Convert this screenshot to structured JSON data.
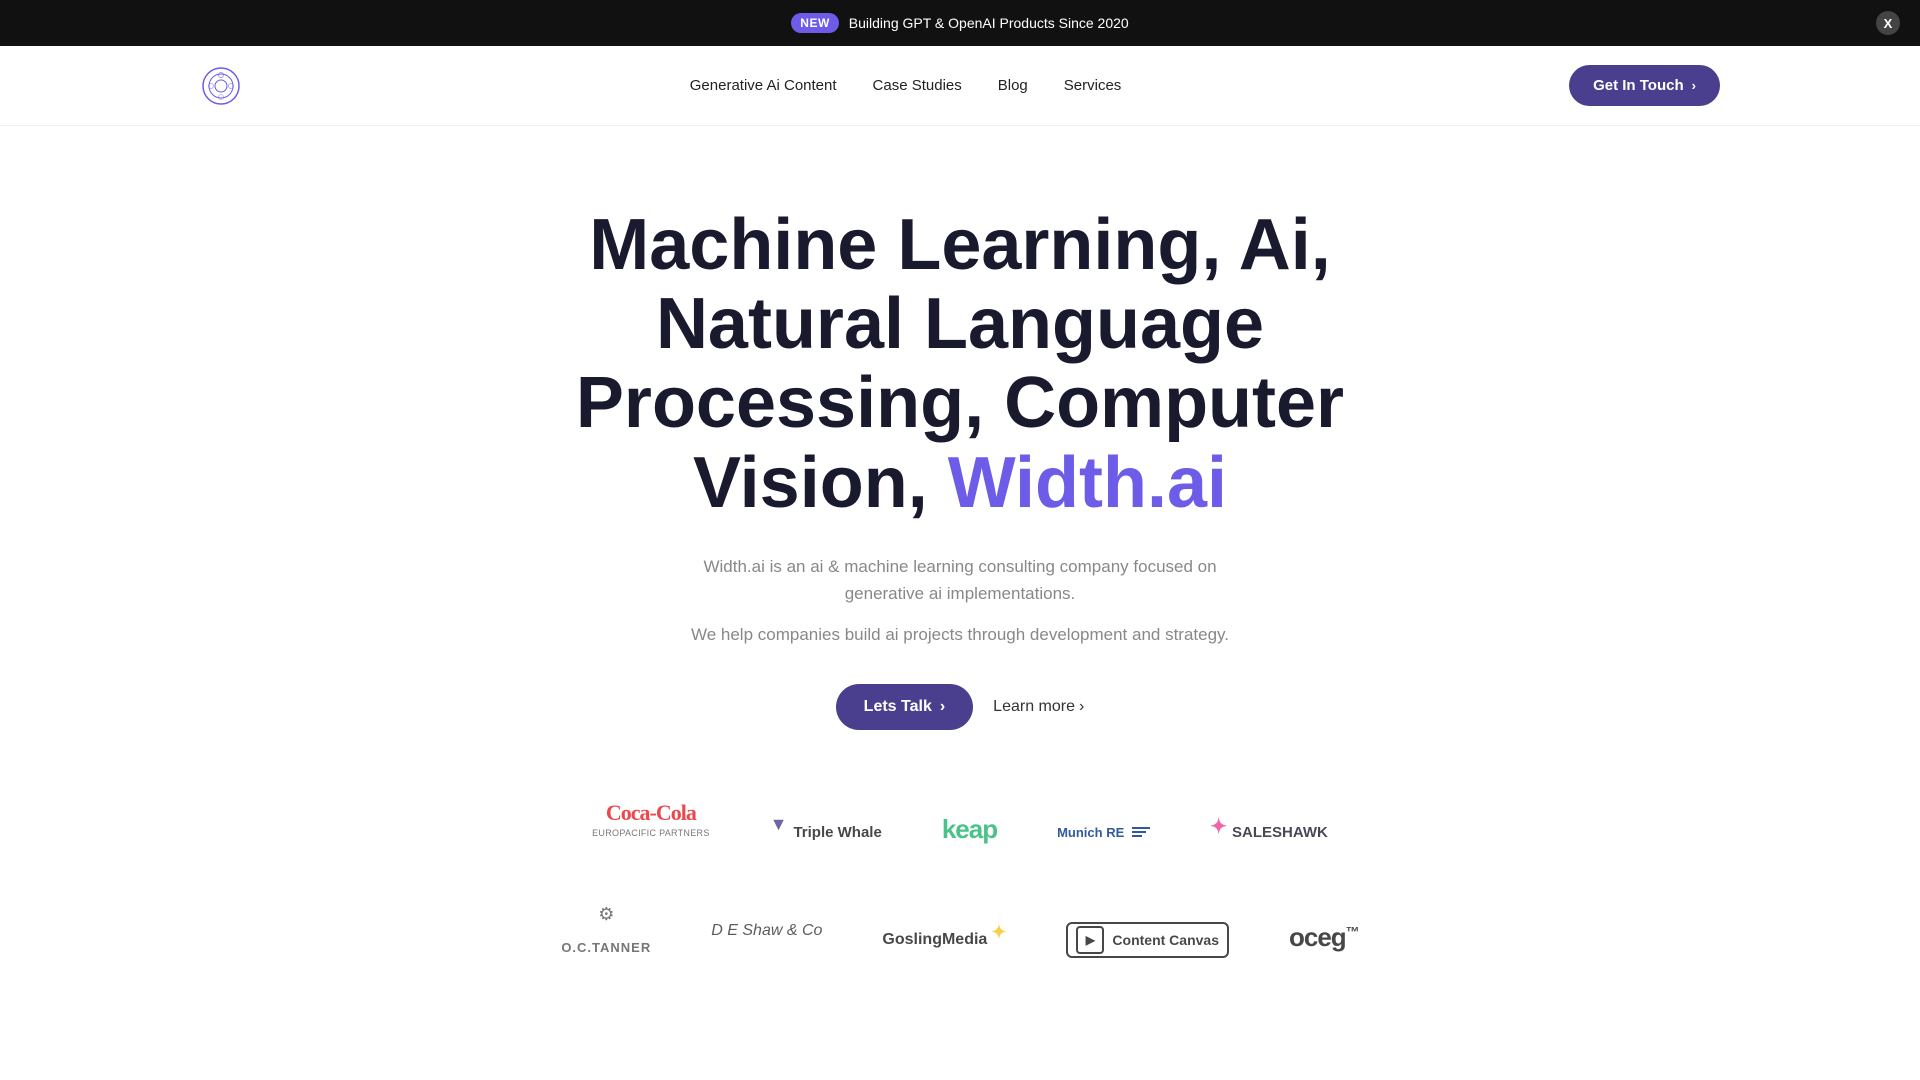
{
  "banner": {
    "badge": "NEW",
    "message": "Building GPT & OpenAI Products Since 2020",
    "close_label": "X"
  },
  "nav": {
    "links": [
      {
        "label": "Generative Ai Content",
        "href": "#"
      },
      {
        "label": "Case Studies",
        "href": "#"
      },
      {
        "label": "Blog",
        "href": "#"
      },
      {
        "label": "Services",
        "href": "#"
      }
    ],
    "cta_label": "Get In Touch",
    "cta_arrow": "›"
  },
  "hero": {
    "headline_part1": "Machine Learning, Ai, Natural Language Processing, Computer Vision, ",
    "headline_accent": "Width.ai",
    "subtitle1": "Width.ai is an ai & machine learning consulting company focused on generative ai implementations.",
    "subtitle2": "We help companies build ai projects through development and strategy.",
    "btn_lets_talk": "Lets Talk",
    "btn_arrow": "›",
    "btn_learn_more": "Learn more",
    "learn_more_arrow": "›"
  },
  "partners": {
    "row1": [
      {
        "name": "Coca-Cola Europacific Partners",
        "id": "cocacola"
      },
      {
        "name": "Triple Whale",
        "id": "triplewhale"
      },
      {
        "name": "Keap",
        "id": "keap"
      },
      {
        "name": "Munich RE",
        "id": "munich"
      },
      {
        "name": "SalesHawk",
        "id": "saleshawk"
      }
    ],
    "row2": [
      {
        "name": "O.C. Tanner",
        "id": "octanner"
      },
      {
        "name": "DE Shaw & Co",
        "id": "deshaw"
      },
      {
        "name": "Gosling Media",
        "id": "gosling"
      },
      {
        "name": "Content Canvas",
        "id": "contentcanvas"
      },
      {
        "name": "OCEG",
        "id": "oceg"
      }
    ]
  }
}
